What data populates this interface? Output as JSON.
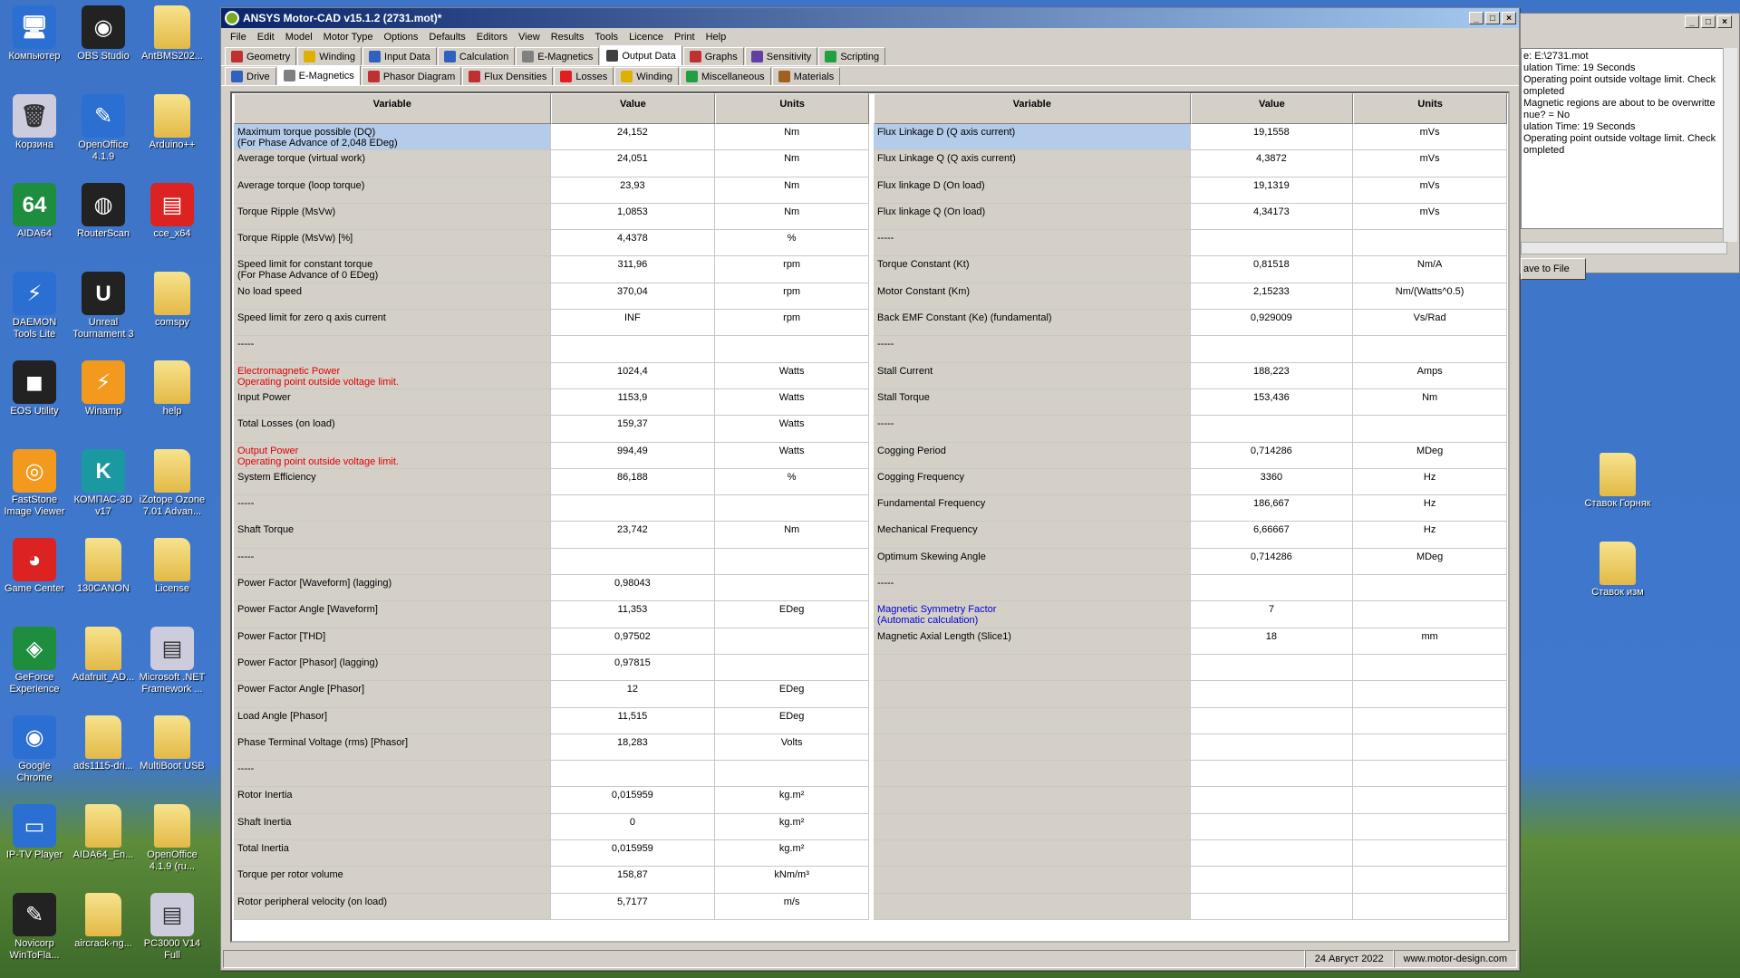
{
  "desktop": {
    "icons": [
      {
        "label": "Компьютер",
        "glyph": "🖥"
      },
      {
        "label": "OBS Studio",
        "glyph": "◉"
      },
      {
        "label": "AntBMS202...",
        "glyph": ""
      },
      {
        "label": "Корзина",
        "glyph": "🗑"
      },
      {
        "label": "OpenOffice 4.1.9",
        "glyph": "✎"
      },
      {
        "label": "Arduino++",
        "glyph": ""
      },
      {
        "label": "AIDA64",
        "glyph": "64"
      },
      {
        "label": "RouterScan",
        "glyph": "◍"
      },
      {
        "label": "cce_x64",
        "glyph": "▤"
      },
      {
        "label": "DAEMON Tools Lite",
        "glyph": "⚡"
      },
      {
        "label": "Unreal Tournament 3",
        "glyph": "U"
      },
      {
        "label": "comspy",
        "glyph": ""
      },
      {
        "label": "EOS Utility",
        "glyph": "◼"
      },
      {
        "label": "Winamp",
        "glyph": "⚡"
      },
      {
        "label": "help",
        "glyph": ""
      },
      {
        "label": "FastStone Image Viewer",
        "glyph": "◎"
      },
      {
        "label": "КОМПАС-3D v17",
        "glyph": "K"
      },
      {
        "label": "iZotope Ozone 7.01 Advan...",
        "glyph": ""
      },
      {
        "label": "Game Center",
        "glyph": "◕"
      },
      {
        "label": "130CANON",
        "glyph": ""
      },
      {
        "label": "License",
        "glyph": ""
      },
      {
        "label": "GeForce Experience",
        "glyph": "◈"
      },
      {
        "label": "Adafruit_AD...",
        "glyph": ""
      },
      {
        "label": "Microsoft .NET Framework ...",
        "glyph": "▤"
      },
      {
        "label": "Google Chrome",
        "glyph": "◉"
      },
      {
        "label": "ads1115-dri...",
        "glyph": ""
      },
      {
        "label": "MultiBoot USB",
        "glyph": ""
      },
      {
        "label": "IP-TV Player",
        "glyph": "▭"
      },
      {
        "label": "AIDA64_En...",
        "glyph": ""
      },
      {
        "label": "OpenOffice 4.1.9 (ru...",
        "glyph": ""
      },
      {
        "label": "Novicorp WinToFla...",
        "glyph": "✎"
      },
      {
        "label": "aircrack-ng...",
        "glyph": ""
      },
      {
        "label": "PC3000 V14 Full",
        "glyph": "▤"
      }
    ],
    "right_icons": [
      {
        "label": "Ставок Горняк"
      },
      {
        "label": "Ставок изм"
      }
    ]
  },
  "window": {
    "title": "ANSYS Motor-CAD v15.1.2 (2731.mot)*",
    "menu": [
      "File",
      "Edit",
      "Model",
      "Motor Type",
      "Options",
      "Defaults",
      "Editors",
      "View",
      "Results",
      "Tools",
      "Licence",
      "Print",
      "Help"
    ],
    "tabs_top": [
      {
        "label": "Geometry",
        "color": "#c03030"
      },
      {
        "label": "Winding",
        "color": "#e0b000"
      },
      {
        "label": "Input Data",
        "color": "#3060c0"
      },
      {
        "label": "Calculation",
        "color": "#3060c0"
      },
      {
        "label": "E-Magnetics",
        "color": "#808080"
      },
      {
        "label": "Output Data",
        "color": "#404040"
      },
      {
        "label": "Graphs",
        "color": "#c03030"
      },
      {
        "label": "Sensitivity",
        "color": "#6040a0"
      },
      {
        "label": "Scripting",
        "color": "#20a040"
      }
    ],
    "tabs_sub": [
      {
        "label": "Drive",
        "color": "#3060c0"
      },
      {
        "label": "E-Magnetics",
        "color": "#808080"
      },
      {
        "label": "Phasor Diagram",
        "color": "#c03030"
      },
      {
        "label": "Flux Densities",
        "color": "#c03030"
      },
      {
        "label": "Losses",
        "color": "#e02020"
      },
      {
        "label": "Winding",
        "color": "#e0b000"
      },
      {
        "label": "Miscellaneous",
        "color": "#20a040"
      },
      {
        "label": "Materials",
        "color": "#a06020"
      }
    ],
    "status": {
      "date": "24 Август 2022",
      "site": "www.motor-design.com"
    }
  },
  "headers": {
    "variable": "Variable",
    "value": "Value",
    "units": "Units"
  },
  "left_rows": [
    {
      "var": "Maximum torque possible (DQ)",
      "var2": "(For Phase Advance of 2,048 EDeg)",
      "val": "24,152",
      "unit": "Nm",
      "sel": true
    },
    {
      "var": "Average torque (virtual work)",
      "val": "24,051",
      "unit": "Nm"
    },
    {
      "var": "Average torque (loop torque)",
      "val": "23,93",
      "unit": "Nm"
    },
    {
      "var": "Torque Ripple (MsVw)",
      "val": "1,0853",
      "unit": "Nm"
    },
    {
      "var": "Torque Ripple (MsVw) [%]",
      "val": "4,4378",
      "unit": "%"
    },
    {
      "var": "Speed limit for constant torque",
      "var2": "(For Phase Advance of 0 EDeg)",
      "val": "311,96",
      "unit": "rpm"
    },
    {
      "var": "No load speed",
      "val": "370,04",
      "unit": "rpm"
    },
    {
      "var": "Speed limit for zero q axis current",
      "val": "INF",
      "unit": "rpm"
    },
    {
      "var": "-----",
      "val": "",
      "unit": ""
    },
    {
      "var": "Electromagnetic Power",
      "var2": "Operating point outside voltage limit.",
      "val": "1024,4",
      "unit": "Watts",
      "red": true
    },
    {
      "var": "Input Power",
      "val": "1153,9",
      "unit": "Watts"
    },
    {
      "var": "Total Losses (on load)",
      "val": "159,37",
      "unit": "Watts"
    },
    {
      "var": "Output Power",
      "var2": "Operating point outside voltage limit.",
      "val": "994,49",
      "unit": "Watts",
      "red": true
    },
    {
      "var": "System Efficiency",
      "val": "86,188",
      "unit": "%"
    },
    {
      "var": "-----",
      "val": "",
      "unit": ""
    },
    {
      "var": "Shaft Torque",
      "val": "23,742",
      "unit": "Nm"
    },
    {
      "var": "-----",
      "val": "",
      "unit": ""
    },
    {
      "var": "Power Factor [Waveform] (lagging)",
      "val": "0,98043",
      "unit": ""
    },
    {
      "var": "Power Factor Angle [Waveform]",
      "val": "11,353",
      "unit": "EDeg"
    },
    {
      "var": "Power Factor [THD]",
      "val": "0,97502",
      "unit": ""
    },
    {
      "var": "Power Factor [Phasor] (lagging)",
      "val": "0,97815",
      "unit": ""
    },
    {
      "var": "Power Factor Angle [Phasor]",
      "val": "12",
      "unit": "EDeg"
    },
    {
      "var": "Load Angle [Phasor]",
      "val": "11,515",
      "unit": "EDeg"
    },
    {
      "var": "Phase Terminal Voltage (rms) [Phasor]",
      "val": "18,283",
      "unit": "Volts"
    },
    {
      "var": "-----",
      "val": "",
      "unit": ""
    },
    {
      "var": "Rotor Inertia",
      "val": "0,015959",
      "unit": "kg.m²"
    },
    {
      "var": "Shaft Inertia",
      "val": "0",
      "unit": "kg.m²"
    },
    {
      "var": "Total Inertia",
      "val": "0,015959",
      "unit": "kg.m²"
    },
    {
      "var": "Torque per rotor volume",
      "val": "158,87",
      "unit": "kNm/m³"
    },
    {
      "var": "Rotor peripheral velocity (on load)",
      "val": "5,7177",
      "unit": "m/s"
    }
  ],
  "right_rows": [
    {
      "var": "Flux Linkage D (Q axis current)",
      "val": "19,1558",
      "unit": "mVs",
      "sel": true
    },
    {
      "var": "Flux Linkage Q (Q axis current)",
      "val": "4,3872",
      "unit": "mVs"
    },
    {
      "var": "Flux linkage D (On load)",
      "val": "19,1319",
      "unit": "mVs"
    },
    {
      "var": "Flux linkage Q (On load)",
      "val": "4,34173",
      "unit": "mVs"
    },
    {
      "var": "-----",
      "val": "",
      "unit": ""
    },
    {
      "var": "Torque Constant (Kt)",
      "val": "0,81518",
      "unit": "Nm/A"
    },
    {
      "var": "Motor Constant (Km)",
      "val": "2,15233",
      "unit": "Nm/(Watts^0.5)"
    },
    {
      "var": "Back EMF Constant (Ke) (fundamental)",
      "val": "0,929009",
      "unit": "Vs/Rad"
    },
    {
      "var": "-----",
      "val": "",
      "unit": ""
    },
    {
      "var": "Stall Current",
      "val": "188,223",
      "unit": "Amps"
    },
    {
      "var": "Stall Torque",
      "val": "153,436",
      "unit": "Nm"
    },
    {
      "var": "-----",
      "val": "",
      "unit": ""
    },
    {
      "var": "Cogging Period",
      "val": "0,714286",
      "unit": "MDeg"
    },
    {
      "var": "Cogging Frequency",
      "val": "3360",
      "unit": "Hz"
    },
    {
      "var": "Fundamental Frequency",
      "val": "186,667",
      "unit": "Hz"
    },
    {
      "var": "Mechanical Frequency",
      "val": "6,66667",
      "unit": "Hz"
    },
    {
      "var": "Optimum Skewing Angle",
      "val": "0,714286",
      "unit": "MDeg"
    },
    {
      "var": "-----",
      "val": "",
      "unit": ""
    },
    {
      "var": "Magnetic Symmetry Factor",
      "var2": "(Automatic calculation)",
      "val": "7",
      "unit": "",
      "blue": true
    },
    {
      "var": "Magnetic Axial Length (Slice1)",
      "val": "18",
      "unit": "mm"
    },
    {
      "var": "",
      "val": "",
      "unit": ""
    },
    {
      "var": "",
      "val": "",
      "unit": ""
    },
    {
      "var": "",
      "val": "",
      "unit": ""
    },
    {
      "var": "",
      "val": "",
      "unit": ""
    },
    {
      "var": "",
      "val": "",
      "unit": ""
    },
    {
      "var": "",
      "val": "",
      "unit": ""
    },
    {
      "var": "",
      "val": "",
      "unit": ""
    },
    {
      "var": "",
      "val": "",
      "unit": ""
    },
    {
      "var": "",
      "val": "",
      "unit": ""
    },
    {
      "var": "",
      "val": "",
      "unit": ""
    }
  ],
  "log": {
    "text": "e: E:\\2731.mot\nulation Time: 19 Seconds\nOperating point outside voltage limit. Check\nompleted\nMagnetic regions are about to be overwritte\nnue? = No\nulation Time: 19 Seconds\nOperating point outside voltage limit. Check\nompleted",
    "save_label": "ave to File"
  }
}
